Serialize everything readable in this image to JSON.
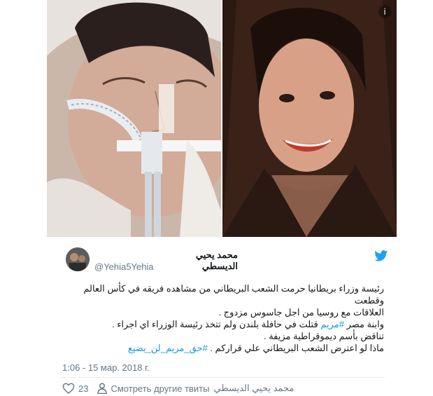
{
  "tweet": {
    "display_name": "محمد يحيي الديسطي",
    "handle": "@Yehia5Yehia",
    "lines": [
      "رئيسة وزراء بريطانيا حرمت الشعب البريطاني من مشاهده فريقه في كأس العالم وقطعت",
      "العلاقات مع روسيا  من اجل جاسوس مزدوج .",
      "وابنة مصر ",
      " قتلت في حافلة بلندن ولم تتخذ رئيسة الوزراء اي اجراء .",
      "تناقض بأسم ديموقراطية مزيفة .",
      "ماذا لو اعترض الشعب البريطاني علي قراركم . "
    ],
    "hashtag_maryam": "#مريم",
    "hashtag_right": "#حق_مريم_لن_يضيع",
    "timestamp": "1:06 - 15 мар. 2018 г.",
    "likes": "23",
    "more_tweets_label": "Смотреть другие твиты",
    "more_tweets_user": "محمد يحيي الديسطي"
  },
  "colors": {
    "accent": "#1b95e0",
    "muted": "#657786",
    "text": "#14171a",
    "divider": "#e6ecf0"
  },
  "icons": {
    "info": "info-icon",
    "bird": "twitter-bird-icon",
    "heart": "heart-icon",
    "person": "person-icon"
  }
}
